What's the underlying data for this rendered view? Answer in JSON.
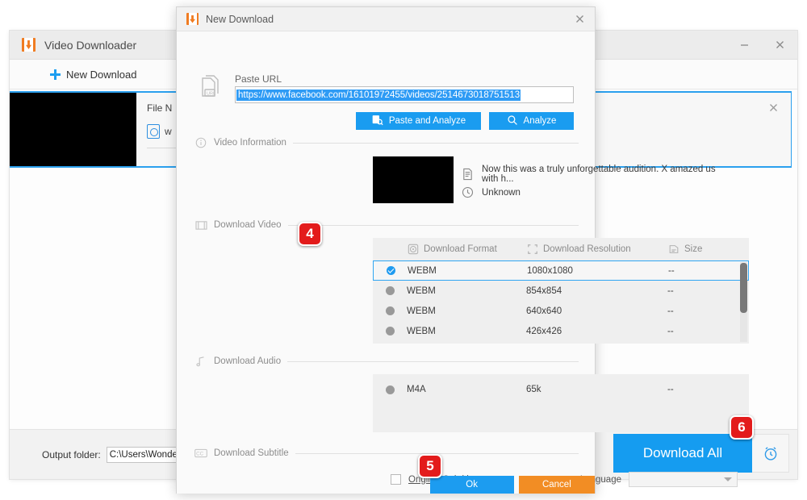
{
  "main_window": {
    "title": "Video Downloader",
    "logo_icon": "app-download-logo-icon",
    "minimize_label": "minimize-icon",
    "close_label": "close-icon",
    "toolbar": {
      "new_download_label": "New Download",
      "plus_icon": "plus-icon"
    },
    "task": {
      "file_name_label": "File N",
      "file_name_value": "w",
      "file_icon": "video-file-icon",
      "close_icon": "close-icon"
    },
    "bottom": {
      "output_folder_label": "Output folder:",
      "output_folder_value": "C:\\Users\\WonderFox\\Do",
      "download_all_label": "Download All",
      "alarm_icon": "alarm-clock-icon"
    }
  },
  "dialog": {
    "title": "New Download",
    "logo_icon": "app-download-logo-icon",
    "close_icon": "close-icon",
    "paste_url": {
      "icon": "clipboard-url-icon",
      "label": "Paste URL",
      "value": "https://www.facebook.com/16101972455/videos/2514673018751513",
      "placeholder": "Paste URL here"
    },
    "actions": {
      "paste_and_analyze_label": "Paste and Analyze",
      "paste_and_analyze_icon": "clipboard-search-icon",
      "analyze_label": "Analyze",
      "analyze_icon": "search-icon"
    },
    "video_information": {
      "section_label": "Video Information",
      "section_icon": "info-icon",
      "title_icon": "document-icon",
      "title_text": "Now this was a truly unforgettable audition. X amazed us with h...",
      "duration_icon": "clock-icon",
      "duration_text": "Unknown"
    },
    "download_video": {
      "section_label": "Download Video",
      "section_icon": "film-icon",
      "columns": [
        {
          "label": "Download Format",
          "icon": "disc-icon"
        },
        {
          "label": "Download Resolution",
          "icon": "crop-frame-icon"
        },
        {
          "label": "Size",
          "icon": "file-icon"
        }
      ],
      "rows": [
        {
          "format": "WEBM",
          "resolution": "1080x1080",
          "size": "--",
          "selected": true
        },
        {
          "format": "WEBM",
          "resolution": "854x854",
          "size": "--",
          "selected": false
        },
        {
          "format": "WEBM",
          "resolution": "640x640",
          "size": "--",
          "selected": false
        },
        {
          "format": "WEBM",
          "resolution": "426x426",
          "size": "--",
          "selected": false
        }
      ]
    },
    "download_audio": {
      "section_label": "Download Audio",
      "section_icon": "music-note-icon",
      "rows": [
        {
          "format": "M4A",
          "bitrate": "65k",
          "size": "--",
          "selected": false
        }
      ]
    },
    "download_subtitle": {
      "section_label": "Download Subtitle",
      "section_icon": "cc-icon",
      "original_subtitles_label": "Original Subtitles",
      "original_subtitles_checked": false,
      "language_label": "Language",
      "language_value": ""
    },
    "footer": {
      "ok_label": "Ok",
      "cancel_label": "Cancel"
    }
  },
  "badges": {
    "step4": "4",
    "step5": "5",
    "step6": "6"
  },
  "colors": {
    "accent_blue": "#159cf0",
    "brand_orange": "#f07c22",
    "cancel_orange": "#f28d24",
    "badge_red": "#e31b1b",
    "selection_blue": "#2e9bf5"
  }
}
